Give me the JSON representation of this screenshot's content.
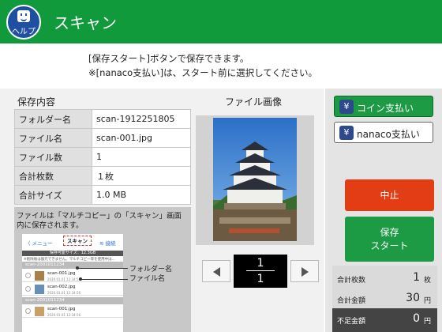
{
  "header": {
    "title": "スキャン",
    "help_label": "ヘルプ",
    "bg_color": "#109a3c"
  },
  "notice": {
    "line1": "[保存スタート]ボタンで保存できます。",
    "line2": "※[nanaco支払い]は、スタート前に選択してください。"
  },
  "contents": {
    "title": "保存内容",
    "rows": [
      {
        "key": "フォルダー名",
        "value": "scan-1912251805"
      },
      {
        "key": "ファイル名",
        "value": "scan-001.jpg"
      },
      {
        "key": "ファイル数",
        "value": "1"
      },
      {
        "key": "合計枚数",
        "value": "１枚"
      },
      {
        "key": "合計サイズ",
        "value": "1.0 MB"
      }
    ]
  },
  "help_note": {
    "text": "ファイルは「マルチコピー」の「スキャン」画面内に保存されます。",
    "callout_folder": "フォルダー名",
    "callout_file": "ファイル名",
    "mini": {
      "back": "〈 メニュー",
      "title": "スキャン",
      "wifi": "≋ 接続",
      "bar": "保存可能サイズ：12.3GB",
      "note": "※削除後は復元できません。マルチコピー等を使用中は…",
      "group1": "scan-2001011234",
      "file1": "scan-001.jpg",
      "date1": "2020.01.01 12:34:56",
      "file2": "scan-002.jpg",
      "date2": "2020.01.01 12:34:56",
      "group2": "scan-2001011234",
      "file3": "scan-001.jpg",
      "date3": "2020.01.01 12:34:56"
    }
  },
  "image": {
    "title": "ファイル画像"
  },
  "pager": {
    "current": "1",
    "total": "1"
  },
  "payment": {
    "coin_label": "コイン支払い",
    "nanaco_label": "nanaco支払い",
    "yen_symbol": "¥"
  },
  "actions": {
    "stop_label": "中止",
    "save_line1": "保存",
    "save_line2": "スタート"
  },
  "summary": {
    "rows": [
      {
        "key": "合計枚数",
        "value": "1",
        "unit": "枚"
      },
      {
        "key": "合計金額",
        "value": "30",
        "unit": "円"
      },
      {
        "key": "不足金額",
        "value": "0",
        "unit": "円"
      }
    ]
  }
}
